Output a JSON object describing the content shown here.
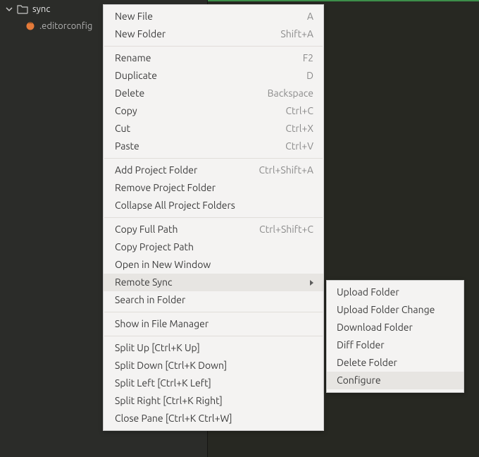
{
  "sidebar": {
    "project_name": "sync",
    "file_name": ".editorconfig"
  },
  "menu": {
    "groups": [
      [
        {
          "label": "New File",
          "shortcut": "A"
        },
        {
          "label": "New Folder",
          "shortcut": "Shift+A"
        }
      ],
      [
        {
          "label": "Rename",
          "shortcut": "F2"
        },
        {
          "label": "Duplicate",
          "shortcut": "D"
        },
        {
          "label": "Delete",
          "shortcut": "Backspace"
        },
        {
          "label": "Copy",
          "shortcut": "Ctrl+C"
        },
        {
          "label": "Cut",
          "shortcut": "Ctrl+X"
        },
        {
          "label": "Paste",
          "shortcut": "Ctrl+V"
        }
      ],
      [
        {
          "label": "Add Project Folder",
          "shortcut": "Ctrl+Shift+A"
        },
        {
          "label": "Remove Project Folder",
          "shortcut": ""
        },
        {
          "label": "Collapse All Project Folders",
          "shortcut": ""
        }
      ],
      [
        {
          "label": "Copy Full Path",
          "shortcut": "Ctrl+Shift+C"
        },
        {
          "label": "Copy Project Path",
          "shortcut": ""
        },
        {
          "label": "Open in New Window",
          "shortcut": ""
        },
        {
          "label": "Remote Sync",
          "shortcut": "",
          "submenu": true,
          "highlight": true
        },
        {
          "label": "Search in Folder",
          "shortcut": ""
        }
      ],
      [
        {
          "label": "Show in File Manager",
          "shortcut": ""
        }
      ],
      [
        {
          "label": "Split Up [Ctrl+K Up]",
          "shortcut": ""
        },
        {
          "label": "Split Down [Ctrl+K Down]",
          "shortcut": ""
        },
        {
          "label": "Split Left [Ctrl+K Left]",
          "shortcut": ""
        },
        {
          "label": "Split Right [Ctrl+K Right]",
          "shortcut": ""
        },
        {
          "label": "Close Pane [Ctrl+K Ctrl+W]",
          "shortcut": ""
        }
      ]
    ]
  },
  "submenu": {
    "items": [
      {
        "label": "Upload Folder",
        "highlight": false
      },
      {
        "label": "Upload Folder Change",
        "highlight": false
      },
      {
        "label": "Download Folder",
        "highlight": false
      },
      {
        "label": "Diff Folder",
        "highlight": false
      },
      {
        "label": "Delete Folder",
        "highlight": false
      },
      {
        "label": "Configure",
        "highlight": true
      }
    ]
  }
}
